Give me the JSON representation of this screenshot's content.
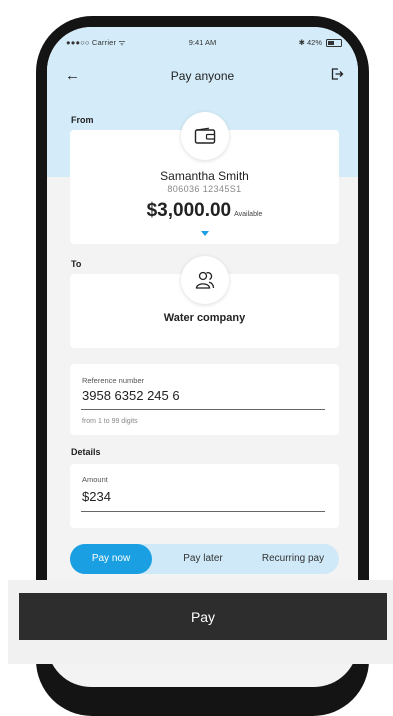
{
  "status_bar": {
    "carrier": "●●●○○ Carrier ᯤ",
    "time": "9:41 AM",
    "battery": "✱ 42%"
  },
  "nav": {
    "title": "Pay anyone"
  },
  "from": {
    "label": "From",
    "name": "Samantha Smith",
    "account": "806036 12345S1",
    "balance": "$3,000.00",
    "balance_suffix": "Available"
  },
  "to": {
    "label": "To",
    "name": "Water company"
  },
  "reference": {
    "label": "Reference number",
    "value": "3958 6352 245 6",
    "hint": "from 1 to 99 digits"
  },
  "details": {
    "label": "Details",
    "amount_label": "Amount",
    "amount_value": "$234"
  },
  "schedule": {
    "options": [
      "Pay now",
      "Pay later",
      "Recurring pay"
    ],
    "selected": "Pay now"
  },
  "pay_button": {
    "label": "Pay"
  },
  "colors": {
    "accent": "#1aa0e2",
    "header_bg": "#d4ecf9",
    "pay_button": "#2d2d2d"
  }
}
